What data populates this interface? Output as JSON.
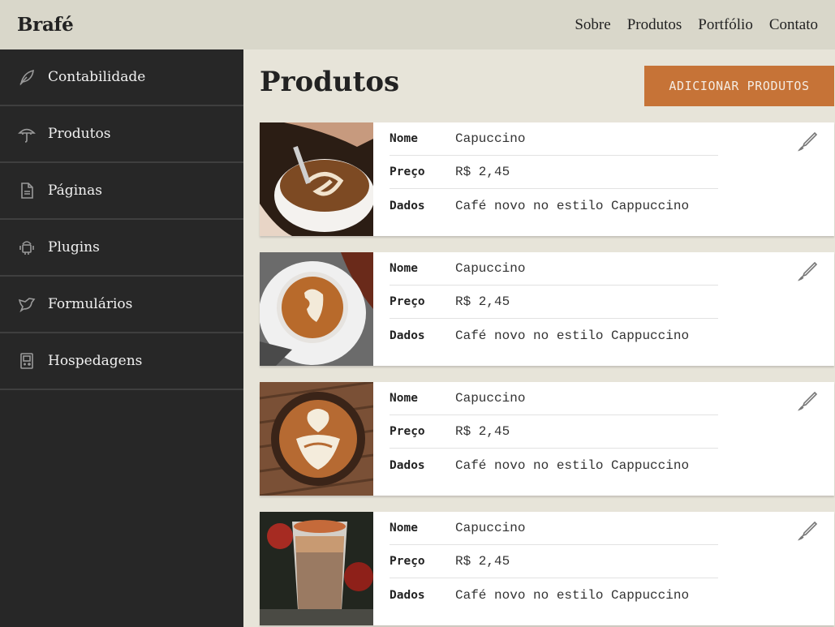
{
  "header": {
    "brand": "Brafé",
    "nav": [
      "Sobre",
      "Produtos",
      "Portfólio",
      "Contato"
    ]
  },
  "sidebar": {
    "items": [
      {
        "label": "Contabilidade",
        "icon": "leaf-icon"
      },
      {
        "label": "Produtos",
        "icon": "umbrella-icon"
      },
      {
        "label": "Páginas",
        "icon": "document-icon"
      },
      {
        "label": "Plugins",
        "icon": "android-icon"
      },
      {
        "label": "Formulários",
        "icon": "bird-icon"
      },
      {
        "label": "Hospedagens",
        "icon": "gameboy-icon"
      }
    ]
  },
  "main": {
    "title": "Produtos",
    "add_button": "ADICIONAR PRODUTOS",
    "field_labels": {
      "name": "Nome",
      "price": "Preço",
      "data": "Dados"
    },
    "products": [
      {
        "name": "Capuccino",
        "price": "R$ 2,45",
        "data": "Café novo no estilo Cappuccino",
        "image": "latte-art-pouring"
      },
      {
        "name": "Capuccino",
        "price": "R$ 2,45",
        "data": "Café novo no estilo Cappuccino",
        "image": "latte-on-saucer-autumn-leaves"
      },
      {
        "name": "Capuccino",
        "price": "R$ 2,45",
        "data": "Café novo no estilo Cappuccino",
        "image": "latte-art-on-wooden-table"
      },
      {
        "name": "Capuccino",
        "price": "R$ 2,45",
        "data": "Café novo no estilo Cappuccino",
        "image": "iced-latte-glass-with-cinnamon"
      }
    ]
  },
  "colors": {
    "topbar": "#d9d7ca",
    "sidebar": "#272727",
    "background": "#e7e4d9",
    "accent": "#c67337"
  }
}
